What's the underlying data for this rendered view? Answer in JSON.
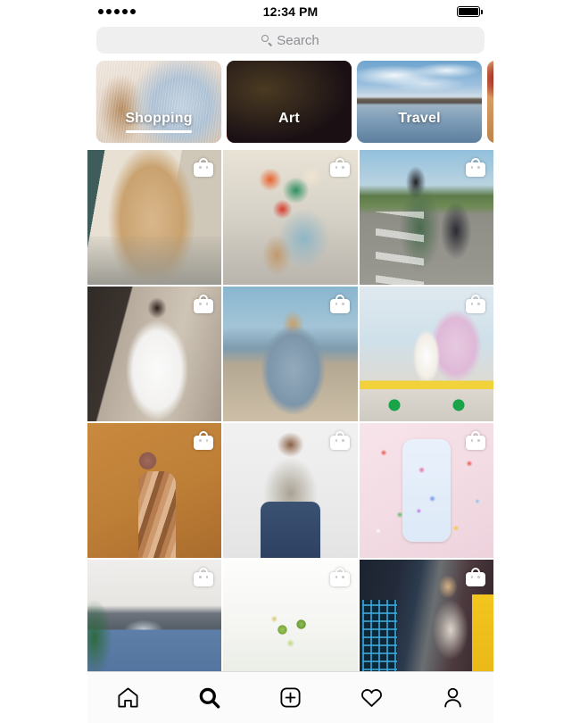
{
  "status_bar": {
    "signal_dots": 5,
    "time": "12:34 PM",
    "battery_level": 100
  },
  "search": {
    "placeholder": "Search",
    "value": "",
    "icon": "search-icon"
  },
  "categories": {
    "items": [
      {
        "label": "Shopping",
        "active": true,
        "art": "art-shopping",
        "image_desc": "light blue knit sweater on cream background"
      },
      {
        "label": "Art",
        "active": false,
        "art": "art-art",
        "image_desc": "holographic iridescent streaks on dark background"
      },
      {
        "label": "Travel",
        "active": false,
        "art": "art-travel",
        "image_desc": "lake and dock under cloudy blue sky"
      },
      {
        "label": "",
        "active": false,
        "art": "art-food",
        "image_desc": "partially visible red and peach food photo"
      }
    ]
  },
  "grid": {
    "badge_icon": "shopping-bag-icon",
    "posts": [
      {
        "alt": "woman in tan trench coat walking past storefront",
        "art": "p-trench",
        "shoppable": true
      },
      {
        "alt": "floral print pants and sandals on pavement",
        "art": "p-floral",
        "shoppable": true
      },
      {
        "alt": "man with backpack and sunglasses on palm road",
        "art": "p-backpack",
        "shoppable": true
      },
      {
        "alt": "woman in white dress on stone staircase",
        "art": "p-whitedress",
        "shoppable": true
      },
      {
        "alt": "woman in blue blouse with arms raised by the sea",
        "art": "p-blueblouse",
        "shoppable": true
      },
      {
        "alt": "skincare tube and pink sneaker on yellow skateboard",
        "art": "p-skate",
        "shoppable": true
      },
      {
        "alt": "hand holding compact with makeup swatches on arm",
        "art": "p-compact",
        "shoppable": true
      },
      {
        "alt": "man in floral short sleeve shirt seated",
        "art": "p-shirtman",
        "shoppable": true
      },
      {
        "alt": "printed phone case on pink candy background",
        "art": "p-case",
        "shoppable": true
      },
      {
        "alt": "blue bedding set in bedroom with plants",
        "art": "p-bed",
        "shoppable": true
      },
      {
        "alt": "green gemstone hoop earrings on white",
        "art": "p-earrings",
        "shoppable": true
      },
      {
        "alt": "woman in silver bomber jacket by arcade machines",
        "art": "p-arcade",
        "shoppable": true
      }
    ]
  },
  "tabbar": {
    "items": [
      {
        "name": "home",
        "icon": "home-icon",
        "active": false
      },
      {
        "name": "search",
        "icon": "search-icon",
        "active": true
      },
      {
        "name": "create",
        "icon": "plus-square-icon",
        "active": false
      },
      {
        "name": "activity",
        "icon": "heart-icon",
        "active": false
      },
      {
        "name": "profile",
        "icon": "person-icon",
        "active": false
      }
    ]
  },
  "colors": {
    "background": "#ffffff",
    "search_field": "#efeff0",
    "placeholder_text": "#8e8e93",
    "tabbar_background": "#fbfbfb",
    "tabbar_border": "#dbdbdb",
    "icon": "#000000"
  }
}
